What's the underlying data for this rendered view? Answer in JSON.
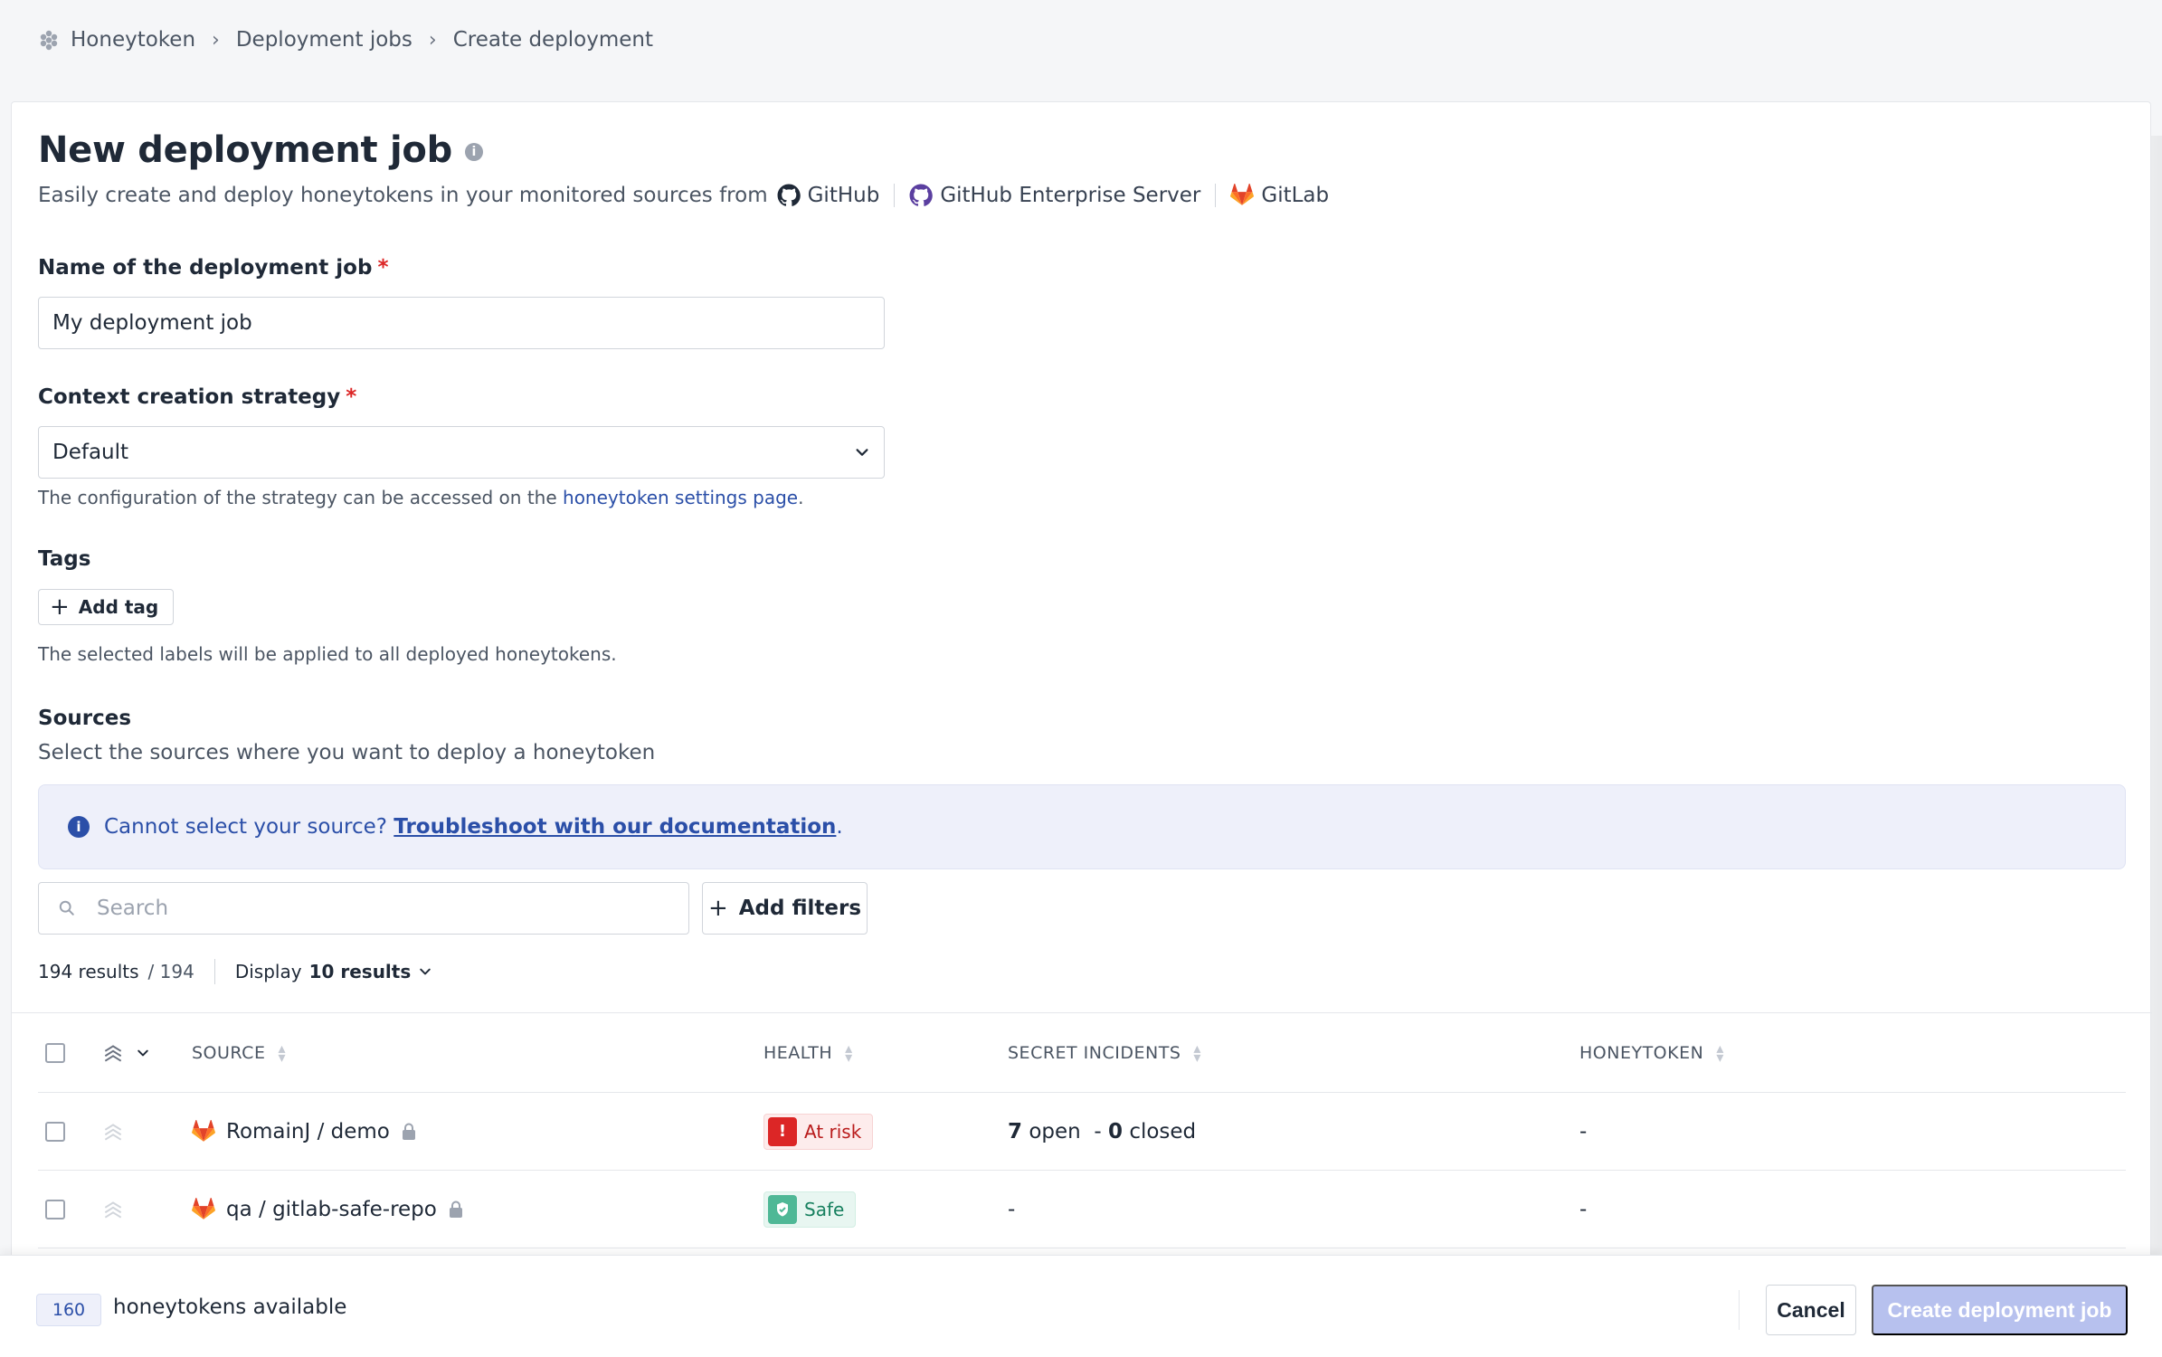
{
  "breadcrumb": {
    "items": [
      "Honeytoken",
      "Deployment jobs",
      "Create deployment"
    ],
    "separator": "›"
  },
  "header": {
    "title": "New deployment job",
    "subtitle_lead": "Easily create and deploy honeytokens in your monitored sources from",
    "providers": [
      "GitHub",
      "GitHub Enterprise Server",
      "GitLab"
    ]
  },
  "form": {
    "name_label": "Name of the deployment job",
    "required_mark": "*",
    "name_value": "My deployment job",
    "strategy_label": "Context creation strategy",
    "strategy_value": "Default",
    "strategy_help_prefix": "The configuration of the strategy can be accessed on the",
    "strategy_help_link": "honeytoken settings page",
    "strategy_help_suffix": ".",
    "tags_label": "Tags",
    "add_tag_label": "Add tag",
    "tags_help": "The selected labels will be applied to all deployed honeytokens."
  },
  "sources": {
    "label": "Sources",
    "description": "Select the sources where you want to deploy a honeytoken",
    "banner_text": "Cannot select your source?",
    "banner_link": "Troubleshoot with our documentation",
    "banner_suffix": ".",
    "search_placeholder": "Search",
    "add_filters_label": "Add filters",
    "results_count": "194 results",
    "results_total": "/ 194",
    "display_prefix": "Display",
    "display_value": "10 results"
  },
  "table": {
    "columns": [
      "SOURCE",
      "HEALTH",
      "SECRET INCIDENTS",
      "HONEYTOKEN"
    ],
    "rows": [
      {
        "source": "RomainJ / demo",
        "health": "At risk",
        "open": "7",
        "open_label": "open",
        "sep": "-",
        "closed": "0",
        "closed_label": "closed",
        "honeytoken": "-"
      },
      {
        "source": "qa / gitlab-safe-repo",
        "health": "Safe",
        "incidents": "-",
        "honeytoken": "-"
      }
    ]
  },
  "footer": {
    "available_count": "160",
    "available_label": "honeytokens available",
    "cancel_label": "Cancel",
    "create_label": "Create deployment job"
  },
  "colors": {
    "accent": "#2b4fa8",
    "disabled_primary": "#b7c1ee",
    "at_risk": "#dc2626",
    "safe": "#4fb896",
    "gitlab": "#e24329"
  }
}
